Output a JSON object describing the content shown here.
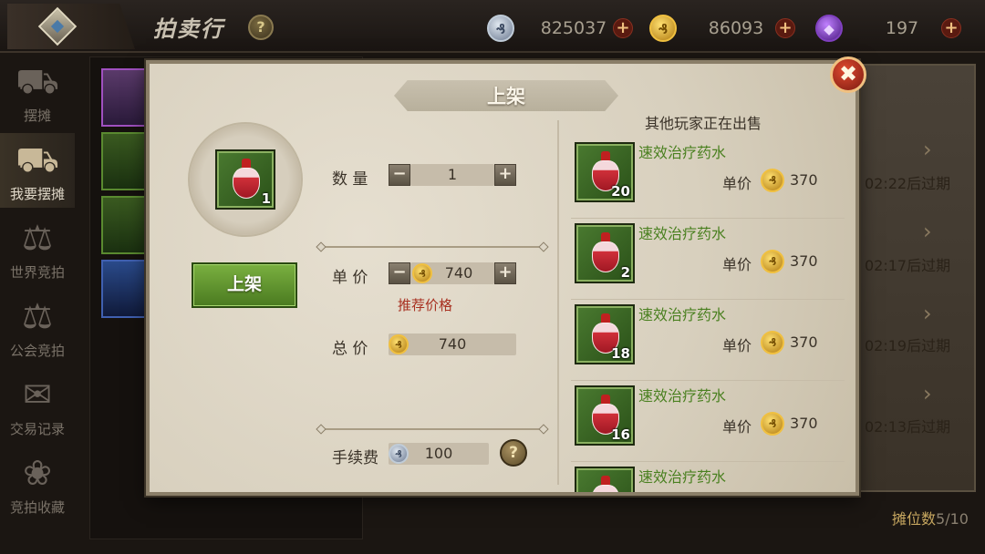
{
  "topbar": {
    "title": "拍卖行",
    "help_label": "?",
    "currencies": [
      {
        "icon": "silver-coin-icon",
        "symbol": "₰",
        "amount": "825037",
        "add_label": "+"
      },
      {
        "icon": "gold-coin-icon",
        "symbol": "₰",
        "amount": "86093",
        "add_label": "+"
      },
      {
        "icon": "purple-gem-icon",
        "symbol": "◆",
        "amount": "197",
        "add_label": "+"
      }
    ]
  },
  "sidebar": {
    "items": [
      {
        "label": "摆摊",
        "icon": "cart-icon",
        "glyph": "⛟",
        "active": false
      },
      {
        "label": "我要摆摊",
        "icon": "stall-cart-icon",
        "glyph": "⛟",
        "active": true
      },
      {
        "label": "世界竞拍",
        "icon": "scales-icon",
        "glyph": "⚖",
        "active": false
      },
      {
        "label": "公会竞拍",
        "icon": "guild-scales-icon",
        "glyph": "⚖",
        "active": false
      },
      {
        "label": "交易记录",
        "icon": "handshake-icon",
        "glyph": "✉",
        "active": false
      },
      {
        "label": "竞拍收藏",
        "icon": "collection-icon",
        "glyph": "❀",
        "active": false
      }
    ]
  },
  "background_listings": [
    {
      "time": "02:22后过期",
      "arrow": "›"
    },
    {
      "time": "02:17后过期",
      "arrow": "›"
    },
    {
      "time": "02:19后过期",
      "arrow": "›"
    },
    {
      "time": "02:13后过期",
      "arrow": "›"
    }
  ],
  "stall_count": {
    "label": "摊位数",
    "value": "5/10"
  },
  "modal": {
    "title": "上架",
    "close_label": "✖",
    "item": {
      "name": "速效治疗药水",
      "count": "1"
    },
    "list_button": "上架",
    "quantity": {
      "label": "数  量",
      "value": "1",
      "minus": "−",
      "plus": "+"
    },
    "unit_price": {
      "label": "单  价",
      "value": "740",
      "minus": "−",
      "plus": "+",
      "coin_symbol": "₰"
    },
    "recommended_label": "推荐价格",
    "total_price": {
      "label": "总  价",
      "value": "740",
      "coin_symbol": "₰"
    },
    "fee": {
      "label": "手续费",
      "value": "100",
      "coin_symbol": "₰",
      "help_label": "?"
    },
    "others_title": "其他玩家正在出售",
    "listings": [
      {
        "name": "速效治疗药水",
        "count": "20",
        "price_label": "单价",
        "price": "370",
        "coin_symbol": "₰"
      },
      {
        "name": "速效治疗药水",
        "count": "2",
        "price_label": "单价",
        "price": "370",
        "coin_symbol": "₰"
      },
      {
        "name": "速效治疗药水",
        "count": "18",
        "price_label": "单价",
        "price": "370",
        "coin_symbol": "₰"
      },
      {
        "name": "速效治疗药水",
        "count": "16",
        "price_label": "单价",
        "price": "370",
        "coin_symbol": "₰"
      },
      {
        "name": "速效治疗药水"
      }
    ]
  },
  "colors": {
    "gold": "#f0c040",
    "green_text": "#4a8020",
    "red_text": "#a83020",
    "button_green": "#6aa038"
  }
}
